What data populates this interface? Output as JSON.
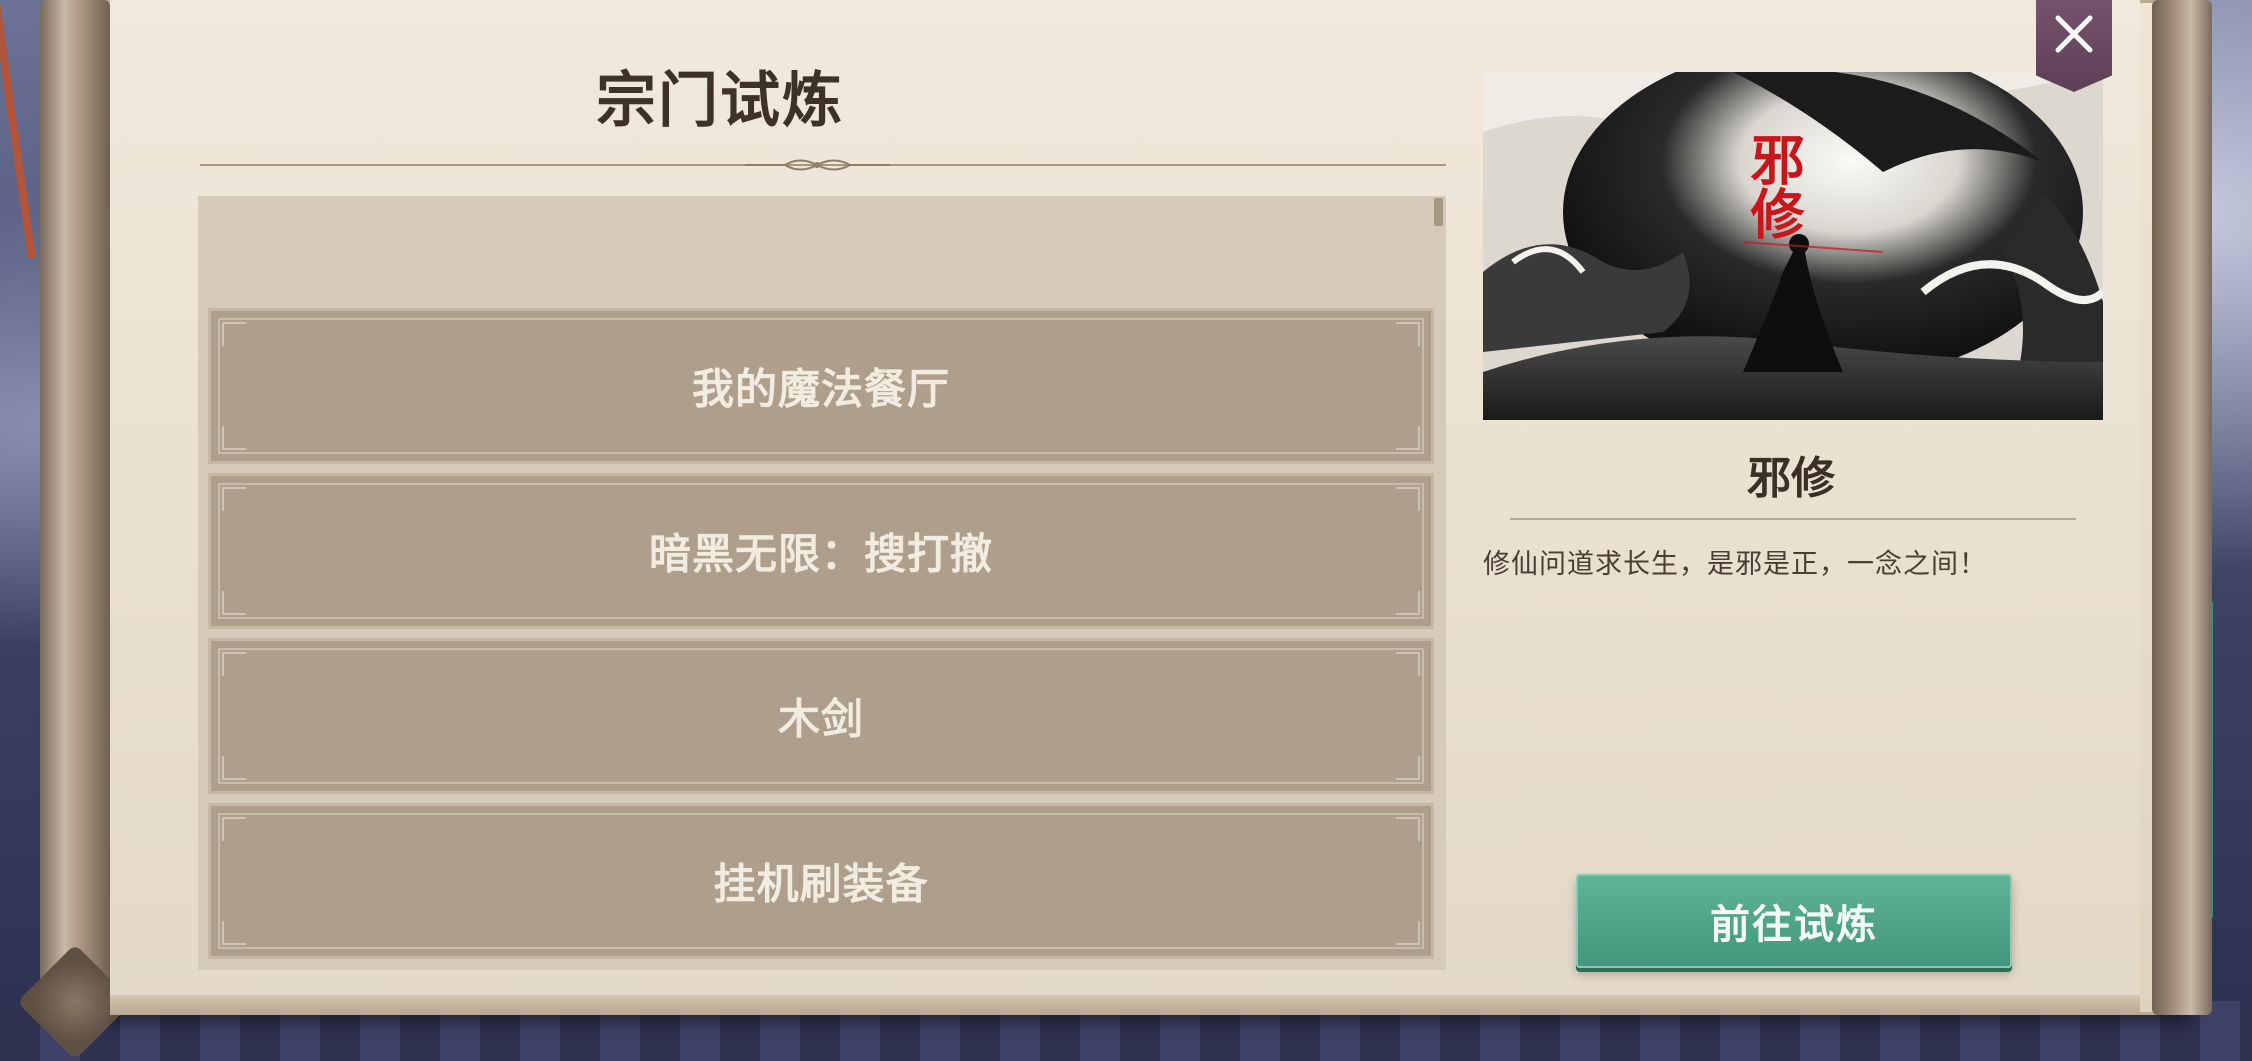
{
  "window": {
    "title": "宗门试炼"
  },
  "list": {
    "items": [
      {
        "label": "我的魔法餐厅"
      },
      {
        "label": "暗黑无限：搜打撤"
      },
      {
        "label": "木剑"
      },
      {
        "label": "挂机刷装备"
      }
    ]
  },
  "detail": {
    "art_title": "邪修",
    "name": "邪修",
    "description": "修仙问道求长生，是邪是正，一念之间！",
    "go_button_label": "前往试炼"
  },
  "icons": {
    "close": "close-icon",
    "title_ornament": "ornament-icon"
  },
  "colors": {
    "accent_button": "#4aa386",
    "list_item_bg": "#ae9f8d",
    "close_bg": "#6a4962",
    "art_title_red": "#c8161d"
  }
}
